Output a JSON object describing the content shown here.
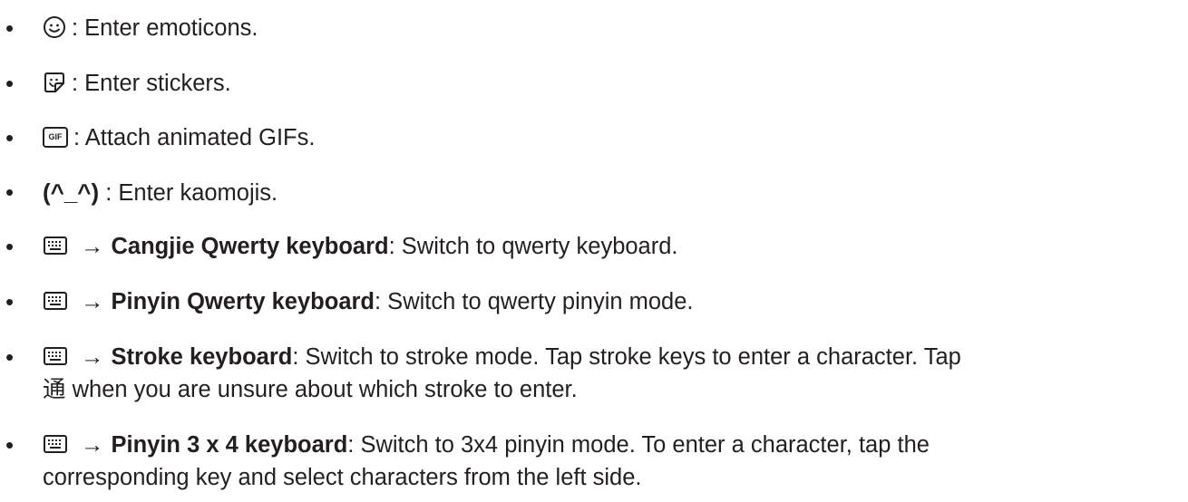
{
  "items": [
    {
      "icon": "smiley-icon",
      "text": ": Enter emoticons."
    },
    {
      "icon": "sticker-icon",
      "text": ": Enter stickers."
    },
    {
      "icon": "gif-icon",
      "icon_text": "GIF",
      "text": ": Attach animated GIFs."
    },
    {
      "icon_text": "(^_^)",
      "text": " : Enter kaomojis."
    },
    {
      "icon": "keyboard-icon",
      "arrow": "→",
      "bold": "Cangjie Qwerty keyboard",
      "text": ": Switch to qwerty keyboard."
    },
    {
      "icon": "keyboard-icon",
      "arrow": "→",
      "bold": "Pinyin Qwerty keyboard",
      "text": ": Switch to qwerty pinyin mode."
    },
    {
      "icon": "keyboard-icon",
      "arrow": "→",
      "bold": "Stroke keyboard",
      "text": ": Switch to stroke mode. Tap stroke keys to enter a character. Tap",
      "line2_char": "通",
      "line2": " when you are unsure about which stroke to enter."
    },
    {
      "icon": "keyboard-icon",
      "arrow": "→",
      "bold": "Pinyin 3 x 4 keyboard",
      "text": ": Switch to 3x4 pinyin mode. To enter a character, tap the",
      "line2": "corresponding key and select characters from the left side."
    }
  ],
  "bullet": "•"
}
